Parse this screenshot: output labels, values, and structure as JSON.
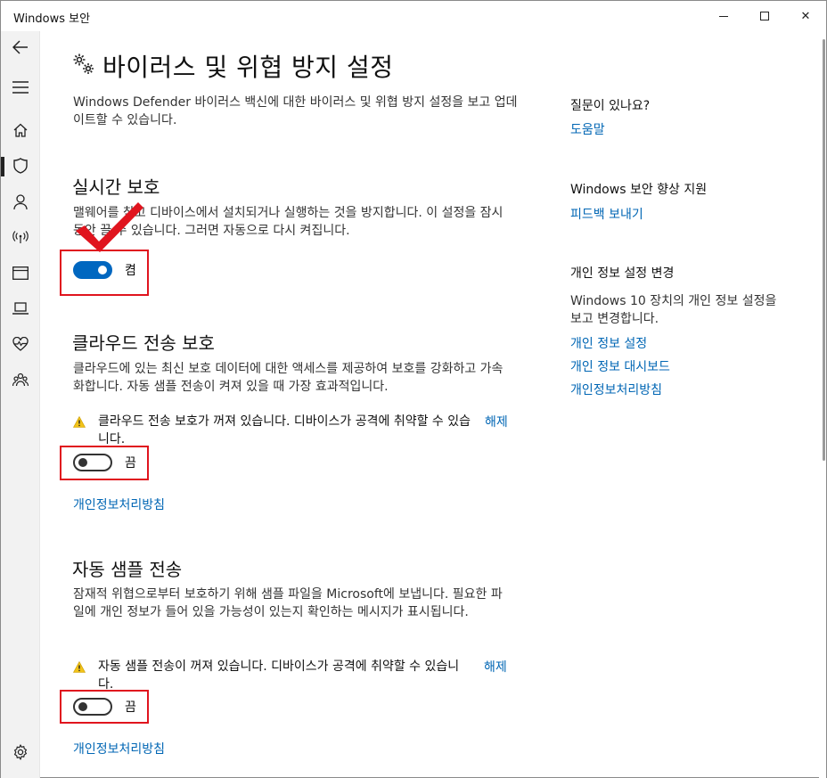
{
  "window": {
    "title": "Windows 보안",
    "minimize_label": "",
    "maximize_label": "",
    "close_label": "✕"
  },
  "nav": {
    "items": [
      "back-icon",
      "menu-icon",
      "home-icon",
      "shield-icon",
      "person-icon",
      "wireless-icon",
      "app-browser-icon",
      "laptop-icon",
      "heart-icon",
      "family-icon",
      "settings-icon"
    ],
    "active_item": "shield-icon"
  },
  "main": {
    "title": "바이러스 및 위협 방지 설정",
    "description": "Windows Defender 바이러스 백신에 대한 바이러스 및 위협 방지 설정을 보고 업데이트할 수 있습니다.",
    "realtime": {
      "heading": "실시간 보호",
      "description": "맬웨어를 찾고 디바이스에서 설치되거나 실행하는 것을 방지합니다. 이 설정을 잠시 동안 끌 수 있습니다. 그러면 자동으로 다시 켜집니다.",
      "toggle_state": "on",
      "toggle_label": "켬"
    },
    "cloud": {
      "heading": "클라우드 전송 보호",
      "description": "클라우드에 있는 최신 보호 데이터에 대한 액세스를 제공하여 보호를 강화하고 가속화합니다. 자동 샘플 전송이 켜져 있을 때 가장 효과적입니다.",
      "warning": "클라우드 전송 보호가 꺼져 있습니다. 디바이스가 공격에 취약할 수 있습니다.",
      "dismiss_label": "해제",
      "toggle_state": "off",
      "toggle_label": "끔",
      "privacy_link": "개인정보처리방침"
    },
    "sample": {
      "heading": "자동 샘플 전송",
      "description": "잠재적 위협으로부터 보호하기 위해 샘플 파일을 Microsoft에 보냅니다. 필요한 파일에 개인 정보가 들어 있을 가능성이 있는지 확인하는 메시지가 표시됩니다.",
      "warning": "자동 샘플 전송이 꺼져 있습니다. 디바이스가 공격에 취약할 수 있습니다.",
      "dismiss_label": "해제",
      "toggle_state": "off",
      "toggle_label": "끔",
      "privacy_link": "개인정보처리방침"
    }
  },
  "side": {
    "question_heading": "질문이 있나요?",
    "help_link": "도움말",
    "improve_heading": "Windows 보안 향상 지원",
    "feedback_link": "피드백 보내기",
    "privacy_heading": "개인 정보 설정 변경",
    "privacy_description": "Windows 10 장치의 개인 정보 설정을 보고 변경합니다.",
    "privacy_settings_link": "개인 정보 설정",
    "privacy_dashboard_link": "개인 정보 대시보드",
    "privacy_policy_link": "개인정보처리방침"
  },
  "colors": {
    "accent": "#0067c0",
    "link": "#0066b4",
    "annotation_red": "#e0141e",
    "warning_yellow": "#f2c318"
  }
}
